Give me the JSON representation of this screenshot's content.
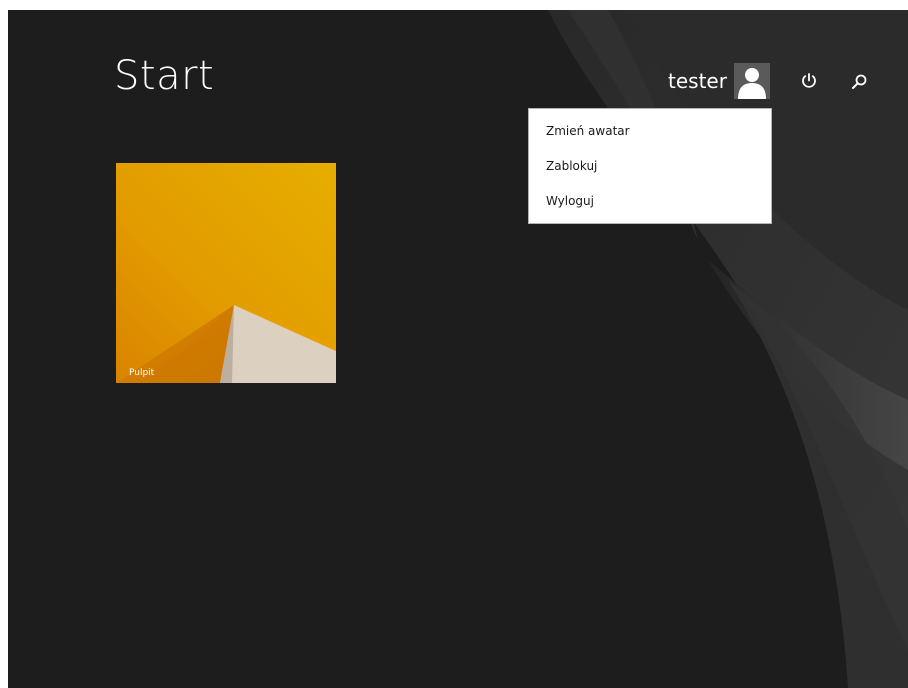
{
  "screen": {
    "title": "Start",
    "background_color": "#1d1d1d"
  },
  "user": {
    "name": "tester",
    "avatar_icon": "user-silhouette-icon"
  },
  "top_buttons": {
    "power_icon": "power-icon",
    "search_icon": "search-icon"
  },
  "account_menu": {
    "items": [
      {
        "label": "Zmień awatar"
      },
      {
        "label": "Zablokuj"
      },
      {
        "label": "Wyloguj"
      }
    ]
  },
  "tiles": [
    {
      "label": "Pulpit",
      "color": "#e8a700"
    }
  ]
}
